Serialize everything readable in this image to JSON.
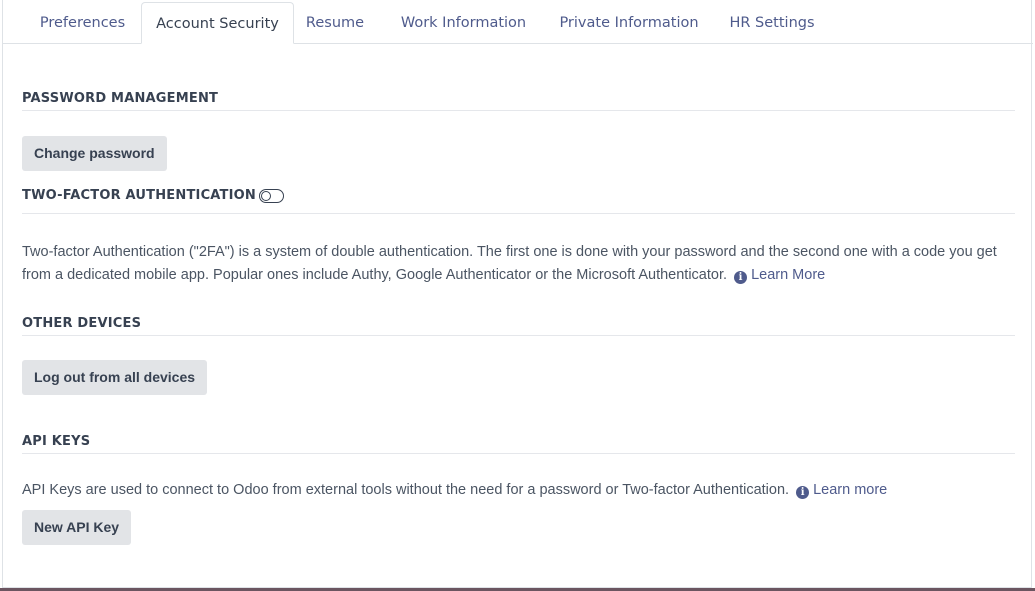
{
  "tabs": [
    {
      "label": "Preferences"
    },
    {
      "label": "Account Security",
      "active": true
    },
    {
      "label": "Resume"
    },
    {
      "label": "Work Information"
    },
    {
      "label": "Private Information"
    },
    {
      "label": "HR Settings"
    }
  ],
  "password": {
    "title": "PASSWORD MANAGEMENT",
    "button": "Change password"
  },
  "two_factor": {
    "title": "TWO-FACTOR AUTHENTICATION",
    "enabled": false,
    "description": "Two-factor Authentication (\"2FA\") is a system of double authentication. The first one is done with your password and the second one with a code you get from a dedicated mobile app. Popular ones include Authy, Google Authenticator or the Microsoft Authenticator.",
    "link": "Learn More"
  },
  "devices": {
    "title": "OTHER DEVICES",
    "button": "Log out from all devices"
  },
  "api_keys": {
    "title": "API KEYS",
    "description": "API Keys are used to connect to Odoo from external tools without the need for a password or Two-factor Authentication.",
    "link": "Learn more",
    "button": "New API Key"
  },
  "colors": {
    "accent": "#4f5b8c",
    "button_bg": "#e2e4e7",
    "text": "#374151"
  }
}
